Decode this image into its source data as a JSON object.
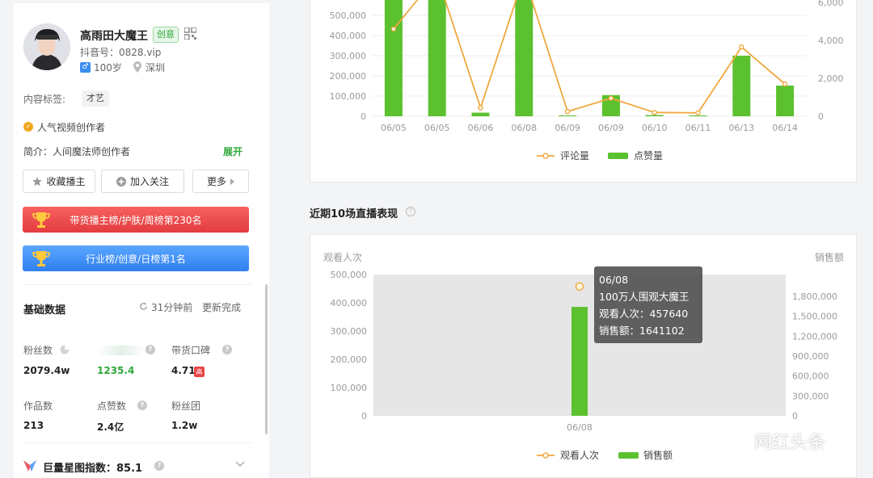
{
  "profile": {
    "name": "高雨田大魔王",
    "badge": "创意",
    "douyin_id": "抖音号：0828.vip",
    "gender_symbol": "♂",
    "age": "100岁",
    "city": "深圳",
    "tag_label": "内容标签:",
    "tag": "才艺",
    "creator_type": "人气视频创作者",
    "bio": "简介：人间魔法师创作者",
    "expand": "展开"
  },
  "actions": {
    "favorite": "收藏播主",
    "follow": "加入关注",
    "more": "更多"
  },
  "ranks": {
    "red": "带货播主榜/护肤/周榜第230名",
    "blue": "行业榜/创意/日榜第1名"
  },
  "basic": {
    "title": "基础数据",
    "update_time": "31分钟前",
    "update_status": "更新完成",
    "fans_label": "粉丝数",
    "fans_value": "2079.4w",
    "growth_value": "1235.4",
    "reputation_label": "带货口碑",
    "reputation_value": "4.71",
    "reputation_badge": "高",
    "works_label": "作品数",
    "works_value": "213",
    "likes_label": "点赞数",
    "likes_value": "2.4亿",
    "fan_group_label": "粉丝团",
    "fan_group_value": "1.2w",
    "star_index": "巨量星图指数：85.1"
  },
  "live_section": {
    "title": "近期10场直播表现"
  },
  "tooltip": {
    "date": "06/08",
    "title": "100万人围观大魔王",
    "views": "观看人次：457640",
    "sales": "销售额：1641102"
  },
  "watermark": "网红头条",
  "colors": {
    "green": "#5cc12f",
    "orange": "#f0a83d",
    "accent_green": "#2ea83a"
  },
  "chart_data": [
    {
      "type": "bar",
      "categories": [
        "06/05",
        "06/05",
        "06/06",
        "06/08",
        "06/09",
        "06/09",
        "06/10",
        "06/11",
        "06/13",
        "06/14"
      ],
      "ylim_left": [
        0,
        500000
      ],
      "ylim_right": [
        0,
        6000
      ],
      "y_ticks_left": [
        "0",
        "100,000",
        "200,000",
        "300,000",
        "400,000",
        "500,000"
      ],
      "y_ticks_right": [
        "0",
        "2,000",
        "4,000",
        "6,000"
      ],
      "series": [
        {
          "name": "点赞量",
          "axis": "left",
          "kind": "bar",
          "values": [
            640000,
            640000,
            18000,
            640000,
            4000,
            105000,
            6000,
            4000,
            300000,
            152000
          ]
        },
        {
          "name": "评论量",
          "axis": "right",
          "kind": "line",
          "values": [
            4600,
            7400,
            450,
            7400,
            250,
            950,
            200,
            180,
            3650,
            1700
          ]
        }
      ],
      "legend": "bottom"
    },
    {
      "type": "bar",
      "categories": [
        "06/08"
      ],
      "ylabel_left": "观看人次",
      "ylabel_right": "销售额",
      "ylim_left": [
        0,
        500000
      ],
      "ylim_right": [
        0,
        1800000
      ],
      "y_ticks_left": [
        "0",
        "100,000",
        "200,000",
        "300,000",
        "400,000",
        "500,000"
      ],
      "y_ticks_right": [
        "0",
        "300,000",
        "600,000",
        "900,000",
        "1,200,000",
        "1,500,000",
        "1,800,000"
      ],
      "series": [
        {
          "name": "销售额",
          "axis": "right",
          "kind": "bar",
          "values": [
            1641102
          ]
        },
        {
          "name": "观看人次",
          "axis": "left",
          "kind": "line",
          "values": [
            457640
          ]
        }
      ],
      "legend": "bottom"
    }
  ]
}
